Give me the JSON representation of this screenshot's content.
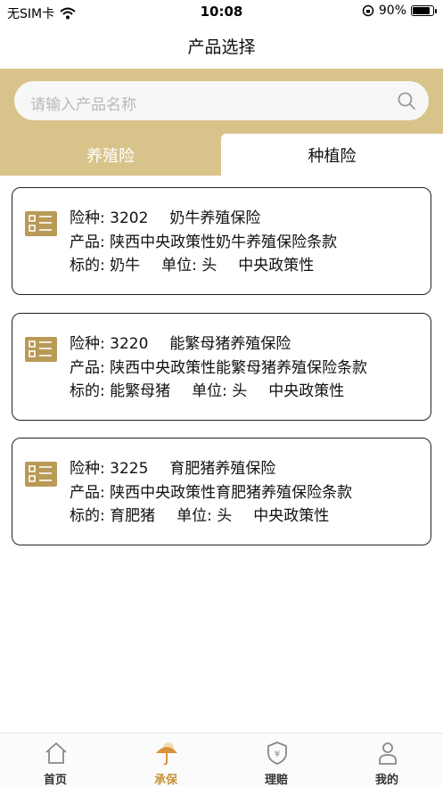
{
  "status_bar": {
    "carrier": "无SIM卡",
    "time": "10:08",
    "battery": "90%",
    "battery_level": 0.9
  },
  "nav": {
    "title": "产品选择"
  },
  "search": {
    "placeholder": "请输入产品名称",
    "icon": "search-icon"
  },
  "tabs": [
    {
      "label": "养殖险",
      "active": true
    },
    {
      "label": "种植险",
      "active": false
    }
  ],
  "products": [
    {
      "code_label": "险种: 3202",
      "name": "奶牛养殖保险",
      "product_line": "产品: 陕西中央政策性奶牛养殖保险条款",
      "subject": "标的: 奶牛",
      "unit": "单位: 头",
      "policy_type": "中央政策性"
    },
    {
      "code_label": "险种: 3220",
      "name": "能繁母猪养殖保险",
      "product_line": "产品: 陕西中央政策性能繁母猪养殖保险条款",
      "subject": "标的: 能繁母猪",
      "unit": "单位: 头",
      "policy_type": "中央政策性"
    },
    {
      "code_label": "险种: 3225",
      "name": "育肥猪养殖保险",
      "product_line": "产品: 陕西中央政策性育肥猪养殖保险条款",
      "subject": "标的: 育肥猪",
      "unit": "单位: 头",
      "policy_type": "中央政策性"
    }
  ],
  "tabbar": [
    {
      "label": "首页",
      "icon": "home-icon",
      "active": false
    },
    {
      "label": "承保",
      "icon": "umbrella-icon",
      "active": true
    },
    {
      "label": "理赔",
      "icon": "shield-yen-icon",
      "active": false
    },
    {
      "label": "我的",
      "icon": "user-icon",
      "active": false
    }
  ],
  "colors": {
    "gold": "#d8c38b",
    "icon_gold": "#b99a56",
    "active_tab": "#c9933a"
  }
}
